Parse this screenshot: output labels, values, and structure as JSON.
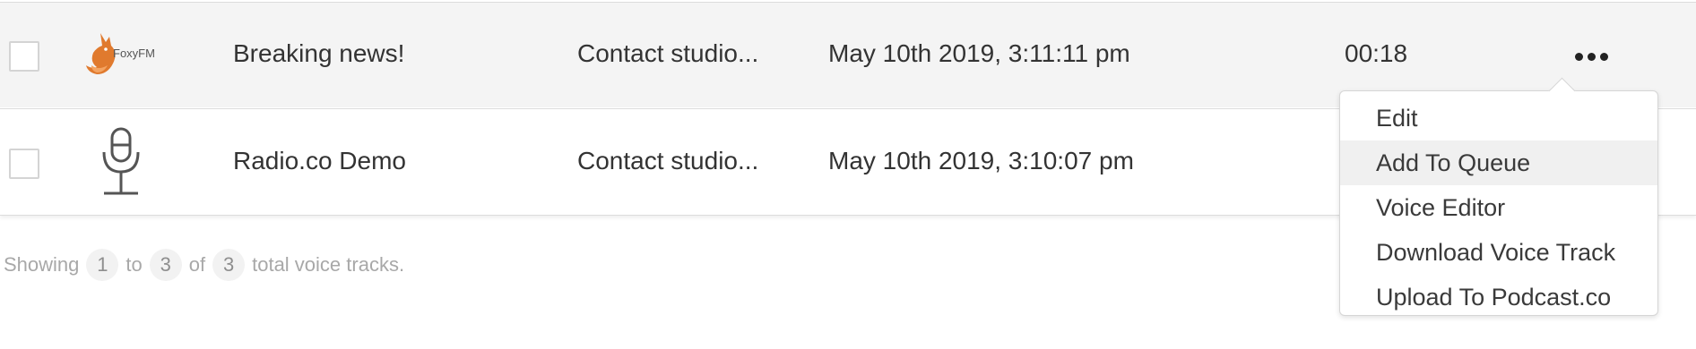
{
  "rows": [
    {
      "thumbnail": "foxyfm-logo",
      "thumbnail_text": "FoxyFM",
      "title": "Breaking news!",
      "description": "Contact studio...",
      "date": "May 10th 2019, 3:11:11 pm",
      "duration": "00:18",
      "selected": false
    },
    {
      "thumbnail": "microphone-icon",
      "title": "Radio.co Demo",
      "description": "Contact studio...",
      "date": "May 10th 2019, 3:10:07 pm",
      "duration": "",
      "selected": false
    }
  ],
  "row_actions_icon": "more-horizontal-icon",
  "dropdown": {
    "items": [
      "Edit",
      "Add To Queue",
      "Voice Editor",
      "Download Voice Track",
      "Upload To Podcast.co"
    ],
    "hovered": "Add To Queue"
  },
  "footer": {
    "prefix": "Showing",
    "from": "1",
    "to_word": "to",
    "to": "3",
    "of_word": "of",
    "total": "3",
    "suffix": "total voice tracks."
  },
  "colors": {
    "active_row_bg": "#f4f4f4",
    "fox_orange": "#e07a2e",
    "menu_hover_bg": "#f0f0f0"
  }
}
